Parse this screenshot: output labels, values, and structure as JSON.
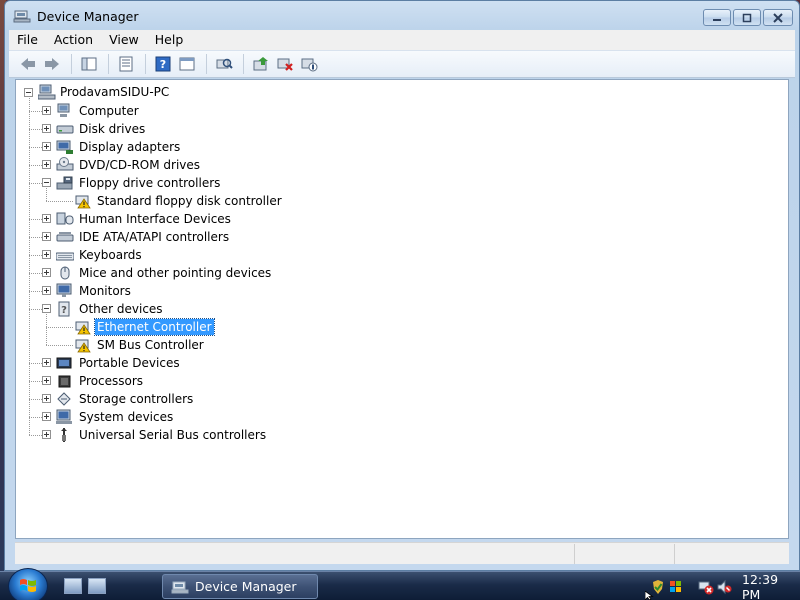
{
  "window": {
    "title": "Device Manager"
  },
  "menubar": {
    "items": [
      "File",
      "Action",
      "View",
      "Help"
    ]
  },
  "toolbar": {
    "buttons": [
      "back-icon",
      "forward-icon",
      "show-hide-tree-icon",
      "properties-icon",
      "help-icon",
      "view-icon",
      "scan-hardware-icon",
      "update-driver-icon",
      "uninstall-icon",
      "disable-icon"
    ]
  },
  "tree": {
    "root": "ProdavamSIDU-PC",
    "items": [
      {
        "label": "Computer",
        "icon": "computer-icon",
        "expanded": false
      },
      {
        "label": "Disk drives",
        "icon": "disk-drive-icon",
        "expanded": false
      },
      {
        "label": "Display adapters",
        "icon": "display-adapter-icon",
        "expanded": false
      },
      {
        "label": "DVD/CD-ROM drives",
        "icon": "dvd-drive-icon",
        "expanded": false
      },
      {
        "label": "Floppy drive controllers",
        "icon": "floppy-controller-icon",
        "expanded": true,
        "children": [
          {
            "label": "Standard floppy disk controller",
            "icon": "warning-device-icon"
          }
        ]
      },
      {
        "label": "Human Interface Devices",
        "icon": "hid-icon",
        "expanded": false
      },
      {
        "label": "IDE ATA/ATAPI controllers",
        "icon": "ide-controller-icon",
        "expanded": false
      },
      {
        "label": "Keyboards",
        "icon": "keyboard-icon",
        "expanded": false
      },
      {
        "label": "Mice and other pointing devices",
        "icon": "mouse-icon",
        "expanded": false
      },
      {
        "label": "Monitors",
        "icon": "monitor-icon",
        "expanded": false
      },
      {
        "label": "Other devices",
        "icon": "other-devices-icon",
        "expanded": true,
        "children": [
          {
            "label": "Ethernet Controller",
            "icon": "warning-device-icon",
            "selected": true
          },
          {
            "label": "SM Bus Controller",
            "icon": "warning-device-icon"
          }
        ]
      },
      {
        "label": "Portable Devices",
        "icon": "portable-device-icon",
        "expanded": false
      },
      {
        "label": "Processors",
        "icon": "processor-icon",
        "expanded": false
      },
      {
        "label": "Storage controllers",
        "icon": "storage-controller-icon",
        "expanded": false
      },
      {
        "label": "System devices",
        "icon": "system-devices-icon",
        "expanded": false
      },
      {
        "label": "Universal Serial Bus controllers",
        "icon": "usb-icon",
        "expanded": false
      }
    ]
  },
  "taskbar": {
    "active_task": "Device Manager",
    "clock": "12:39 PM"
  },
  "colors": {
    "selection": "#3399ff",
    "taskbar": "#1a2b48",
    "warning": "#f5c400"
  }
}
